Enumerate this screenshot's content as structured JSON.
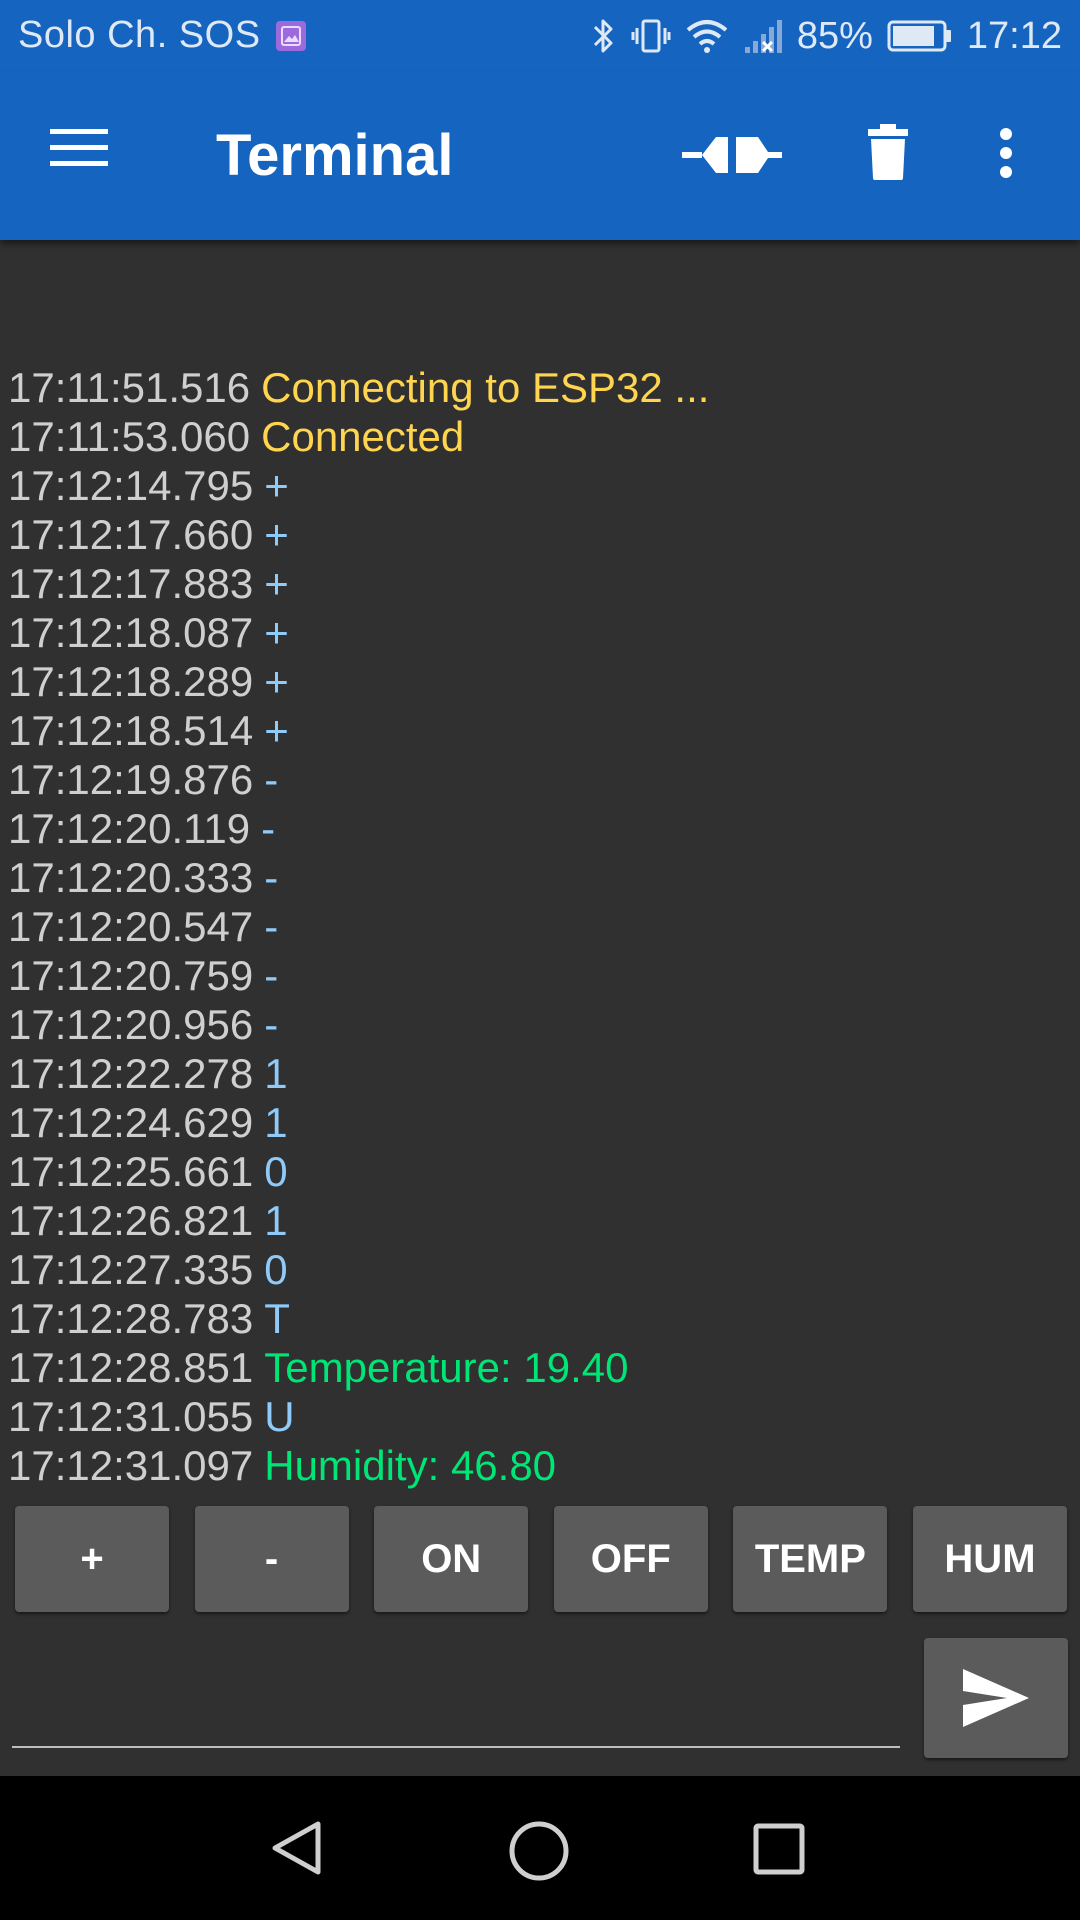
{
  "status_bar": {
    "carrier": "Solo Ch. SOS",
    "battery": "85%",
    "time": "17:12",
    "icons": [
      "gallery-icon",
      "bluetooth-icon",
      "vibrate-icon",
      "wifi-icon",
      "signal-icon",
      "battery-icon"
    ]
  },
  "app_bar": {
    "title": "Terminal",
    "icons": [
      "menu-icon",
      "connect-icon",
      "trash-icon",
      "more-vert-icon"
    ],
    "color": "#1565c0"
  },
  "log": [
    {
      "time": "17:11:51.516",
      "text": "Connecting to ESP32 ...",
      "kind": "status"
    },
    {
      "time": "17:11:53.060",
      "text": "Connected",
      "kind": "status"
    },
    {
      "time": "17:12:14.795",
      "text": "+",
      "kind": "sent"
    },
    {
      "time": "17:12:17.660",
      "text": "+",
      "kind": "sent"
    },
    {
      "time": "17:12:17.883",
      "text": "+",
      "kind": "sent"
    },
    {
      "time": "17:12:18.087",
      "text": "+",
      "kind": "sent"
    },
    {
      "time": "17:12:18.289",
      "text": "+",
      "kind": "sent"
    },
    {
      "time": "17:12:18.514",
      "text": "+",
      "kind": "sent"
    },
    {
      "time": "17:12:19.876",
      "text": "-",
      "kind": "sent"
    },
    {
      "time": "17:12:20.119",
      "text": "-",
      "kind": "sent"
    },
    {
      "time": "17:12:20.333",
      "text": "-",
      "kind": "sent"
    },
    {
      "time": "17:12:20.547",
      "text": "-",
      "kind": "sent"
    },
    {
      "time": "17:12:20.759",
      "text": "-",
      "kind": "sent"
    },
    {
      "time": "17:12:20.956",
      "text": "-",
      "kind": "sent"
    },
    {
      "time": "17:12:22.278",
      "text": "1",
      "kind": "sent"
    },
    {
      "time": "17:12:24.629",
      "text": "1",
      "kind": "sent"
    },
    {
      "time": "17:12:25.661",
      "text": "0",
      "kind": "sent"
    },
    {
      "time": "17:12:26.821",
      "text": "1",
      "kind": "sent"
    },
    {
      "time": "17:12:27.335",
      "text": "0",
      "kind": "sent"
    },
    {
      "time": "17:12:28.783",
      "text": "T",
      "kind": "sent"
    },
    {
      "time": "17:12:28.851",
      "text": "Temperature: 19.40",
      "kind": "received"
    },
    {
      "time": "17:12:31.055",
      "text": "U",
      "kind": "sent"
    },
    {
      "time": "17:12:31.097",
      "text": "Humidity: 46.80",
      "kind": "received"
    }
  ],
  "colors": {
    "status": "#ffd54f",
    "sent": "#90caf9",
    "received": "#00e676",
    "timestamp": "#cfcfcf",
    "background": "#303030"
  },
  "macros": [
    "+",
    "-",
    "ON",
    "OFF",
    "TEMP",
    "HUM"
  ],
  "send": {
    "input_value": "",
    "icon": "send-icon"
  },
  "nav_bar": {
    "icons": [
      "back-icon",
      "home-icon",
      "recents-icon"
    ]
  }
}
